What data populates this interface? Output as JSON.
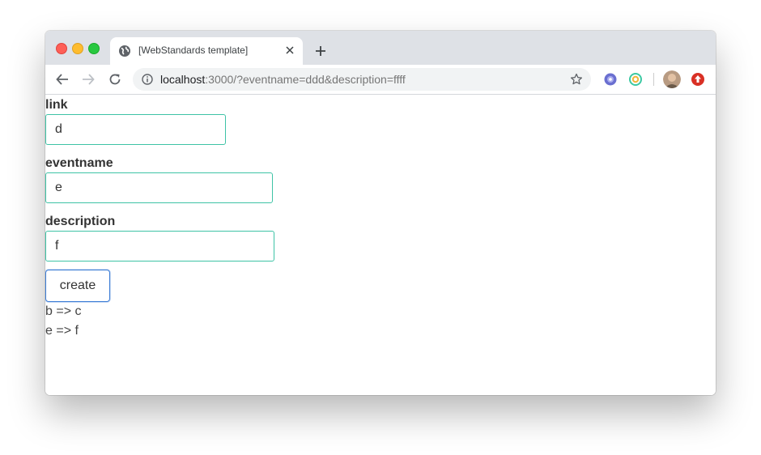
{
  "browser": {
    "tab_title": "[WebStandards template]",
    "url_host": "localhost",
    "url_rest": ":3000/?eventname=ddd&description=ffff"
  },
  "form": {
    "link": {
      "label": "link",
      "value": "d"
    },
    "eventname": {
      "label": "eventname",
      "value": "e"
    },
    "description": {
      "label": "description",
      "value": "f"
    },
    "create_label": "create"
  },
  "results": [
    "b => c",
    "e => f"
  ]
}
